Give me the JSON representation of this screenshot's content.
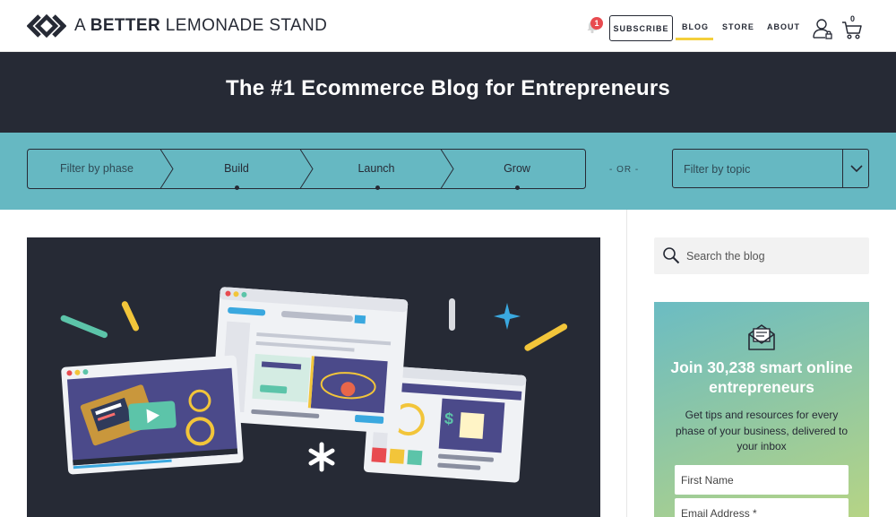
{
  "header": {
    "logo_text_light_1": "A ",
    "logo_text_bold": "BETTER",
    "logo_text_light_2": " LEMONADE STAND",
    "notification_count": "1",
    "subscribe_label": "SUBSCRIBE",
    "nav": [
      "BLOG",
      "STORE",
      "ABOUT"
    ],
    "active_nav": "BLOG",
    "cart_count": "0"
  },
  "hero": {
    "title": "The #1 Ecommerce Blog for Entrepreneurs"
  },
  "filters": {
    "phase_label": "Filter by phase",
    "phases": [
      "Build",
      "Launch",
      "Grow"
    ],
    "or_text": "- OR -",
    "topic_placeholder": "Filter by topic"
  },
  "sidebar": {
    "search_placeholder": "Search the blog",
    "signup_title": "Join 30,238 smart online entrepreneurs",
    "signup_text": "Get tips and resources for every phase of your business, delivered to your inbox",
    "first_name_placeholder": "First Name",
    "email_placeholder": "Email Address *"
  },
  "colors": {
    "dark": "#262a35",
    "teal": "#66b8c2",
    "accent_yellow": "#f4cf3b",
    "badge_red": "#e84b50"
  },
  "icons": [
    "logo-mark-icon",
    "bell-icon",
    "account-icon",
    "cart-icon",
    "chevron-down-icon",
    "search-icon",
    "mail-icon"
  ]
}
